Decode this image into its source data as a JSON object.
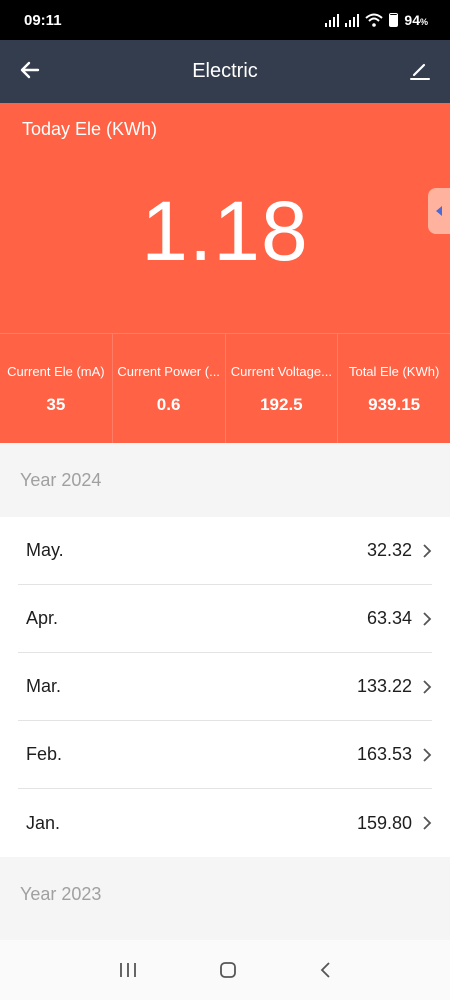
{
  "status_bar": {
    "time": "09:11",
    "battery_percent": "94",
    "battery_unit": "%"
  },
  "app_bar": {
    "title": "Electric",
    "back_icon": "arrow-left-icon",
    "edit_icon": "pencil-icon"
  },
  "hero": {
    "today_label": "Today Ele (KWh)",
    "today_value": "1.18",
    "background_color": "#ff6244",
    "stats": [
      {
        "label": "Current Ele (mA)",
        "value": "35"
      },
      {
        "label": "Current Power (...",
        "value": "0.6"
      },
      {
        "label": "Current Voltage...",
        "value": "192.5"
      },
      {
        "label": "Total Ele (KWh)",
        "value": "939.15"
      }
    ]
  },
  "years": [
    {
      "label": "Year 2024",
      "months": [
        {
          "month": "May.",
          "value": "32.32"
        },
        {
          "month": "Apr.",
          "value": "63.34"
        },
        {
          "month": "Mar.",
          "value": "133.22"
        },
        {
          "month": "Feb.",
          "value": "163.53"
        },
        {
          "month": "Jan.",
          "value": "159.80"
        }
      ]
    },
    {
      "label": "Year 2023",
      "months": []
    }
  ],
  "nav_bar": {
    "icons": [
      "recent-apps-icon",
      "home-icon",
      "back-icon"
    ]
  }
}
